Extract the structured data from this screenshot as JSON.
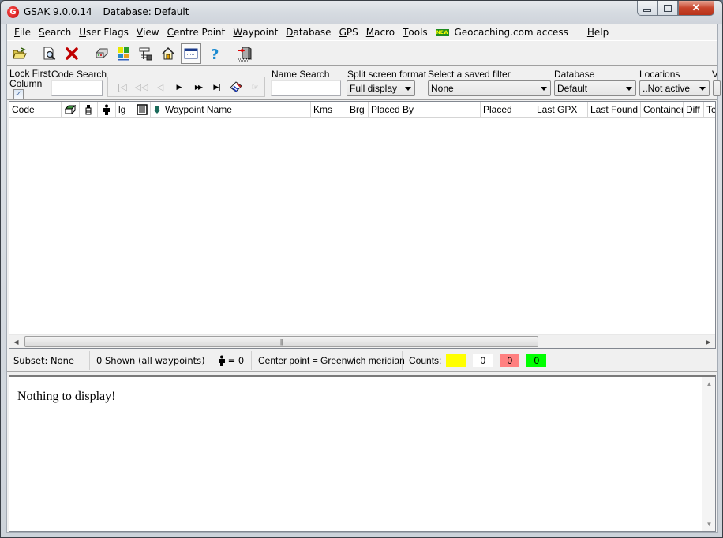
{
  "window": {
    "app_title": "GSAK 9.0.0.14",
    "database_title": "Database: Default",
    "controls": {
      "minimize": "minimize-icon",
      "maximize": "maximize-icon",
      "close": "close-icon"
    }
  },
  "menu": {
    "items": [
      {
        "label": "File",
        "accel": "F"
      },
      {
        "label": "Search",
        "accel": "S"
      },
      {
        "label": "User Flags",
        "accel": "U"
      },
      {
        "label": "View",
        "accel": "V"
      },
      {
        "label": "Centre Point",
        "accel": "C"
      },
      {
        "label": "Waypoint",
        "accel": "W"
      },
      {
        "label": "Database",
        "accel": "D"
      },
      {
        "label": "GPS",
        "accel": "G"
      },
      {
        "label": "Macro",
        "accel": "M"
      },
      {
        "label": "Tools",
        "accel": "T"
      },
      {
        "label": "Geocaching.com access",
        "badge": "NEW"
      },
      {
        "label": "Help",
        "accel": "H"
      }
    ]
  },
  "toolbar": {
    "buttons": [
      {
        "icon": "open-folder-icon"
      },
      {
        "icon": "preview-search-icon"
      },
      {
        "icon": "delete-icon"
      },
      {
        "icon": "printer-icon"
      },
      {
        "icon": "colored-grid-icon"
      },
      {
        "icon": "tools-hammer-icon"
      },
      {
        "icon": "home-icon"
      },
      {
        "icon": "window-icon",
        "active": true
      },
      {
        "icon": "help-icon"
      },
      {
        "icon": "exit-door-icon"
      }
    ]
  },
  "filters": {
    "lock_first_column_label": "Lock First Column",
    "lock_first_column_checked": true,
    "code_search_label": "Code Search",
    "code_search_value": "",
    "nav_buttons": [
      {
        "icon": "first-record-icon",
        "enabled": false
      },
      {
        "icon": "prev-page-icon",
        "enabled": false
      },
      {
        "icon": "prev-record-icon",
        "enabled": false
      },
      {
        "icon": "next-record-icon",
        "enabled": true
      },
      {
        "icon": "next-page-icon",
        "enabled": true
      },
      {
        "icon": "last-record-icon",
        "enabled": true
      },
      {
        "icon": "book-icon",
        "enabled": true
      },
      {
        "icon": "pointing-hand-icon",
        "enabled": false
      }
    ],
    "name_search_label": "Name Search",
    "name_search_value": "",
    "split_screen_label": "Split screen format",
    "split_screen_value": "Full display",
    "saved_filter_label": "Select a saved filter",
    "saved_filter_value": "None",
    "database_label": "Database",
    "database_value": "Default",
    "locations_label": "Locations",
    "locations_value": "..Not active",
    "cut_label": "Vi"
  },
  "grid": {
    "columns": [
      {
        "label": "Code"
      },
      {
        "icon": "cache-box-icon"
      },
      {
        "icon": "bug-icon"
      },
      {
        "icon": "person-icon"
      },
      {
        "label": "lg"
      },
      {
        "icon": "notes-icon"
      },
      {
        "label": "Waypoint Name",
        "sort_icon": "sort-down-arrow-icon"
      },
      {
        "label": "Kms"
      },
      {
        "label": "Brg"
      },
      {
        "label": "Placed By"
      },
      {
        "label": "Placed"
      },
      {
        "label": "Last GPX"
      },
      {
        "label": "Last Found"
      },
      {
        "label": "Container"
      },
      {
        "label": "Diff"
      },
      {
        "label": "Ter"
      }
    ],
    "rows": []
  },
  "status": {
    "subset": "Subset: None",
    "shown": "0 Shown (all waypoints)",
    "found_count": "= 0",
    "center_point": "Center point = Greenwich meridian",
    "counts_label": "Counts:",
    "counts": [
      {
        "value": "",
        "color": "#ffff00"
      },
      {
        "value": "0",
        "color": "#ffffff"
      },
      {
        "value": "0",
        "color": "#ff8080"
      },
      {
        "value": "0",
        "color": "#00ff00"
      }
    ]
  },
  "detail": {
    "message": "Nothing to display!"
  }
}
